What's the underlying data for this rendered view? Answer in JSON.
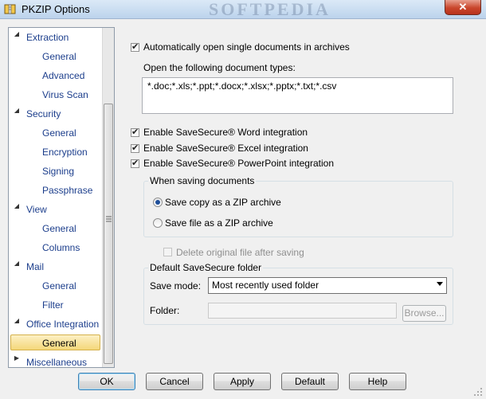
{
  "window": {
    "title": "PKZIP Options",
    "watermark": "SOFTPEDIA",
    "close_glyph": "✕"
  },
  "tree": {
    "groups": [
      {
        "label": "Extraction",
        "expanded": true,
        "children": [
          "General",
          "Advanced",
          "Virus Scan"
        ]
      },
      {
        "label": "Security",
        "expanded": true,
        "children": [
          "General",
          "Encryption",
          "Signing",
          "Passphrase"
        ]
      },
      {
        "label": "View",
        "expanded": true,
        "children": [
          "General",
          "Columns"
        ]
      },
      {
        "label": "Mail",
        "expanded": true,
        "children": [
          "General",
          "Filter"
        ]
      },
      {
        "label": "Office Integration",
        "expanded": true,
        "children": [
          "General"
        ]
      },
      {
        "label": "Miscellaneous",
        "expanded": false,
        "children": []
      }
    ],
    "selected": "Office Integration / General",
    "expanded_arrow": "◢",
    "collapsed_arrow": "▶"
  },
  "options": {
    "auto_open": {
      "label": "Automatically open single documents in archives",
      "checked": true
    },
    "doc_types_label": "Open the following document types:",
    "doc_types_value": "*.doc;*.xls;*.ppt;*.docx;*.xlsx;*.pptx;*.txt;*.csv",
    "word": {
      "label": "Enable SaveSecure® Word integration",
      "checked": true
    },
    "excel": {
      "label": "Enable SaveSecure® Excel integration",
      "checked": true
    },
    "powerpoint": {
      "label": "Enable SaveSecure® PowerPoint integration",
      "checked": true
    }
  },
  "saving_group": {
    "title": "When saving documents",
    "radio_copy": {
      "label": "Save copy as a ZIP archive",
      "selected": true
    },
    "radio_file": {
      "label": "Save file as a ZIP archive",
      "selected": false
    }
  },
  "delete_original": {
    "label": "Delete original file after saving",
    "checked": false,
    "enabled": false
  },
  "folder_group": {
    "title": "Default SaveSecure folder",
    "save_mode_label": "Save mode:",
    "save_mode_value": "Most recently used folder",
    "folder_label": "Folder:",
    "folder_value": "",
    "browse_label": "Browse..."
  },
  "buttons": {
    "ok": "OK",
    "cancel": "Cancel",
    "apply": "Apply",
    "default": "Default",
    "help": "Help"
  },
  "colors": {
    "tree_text": "#1c3e8c",
    "selection": "#f4d77a",
    "close": "#c9462c"
  }
}
